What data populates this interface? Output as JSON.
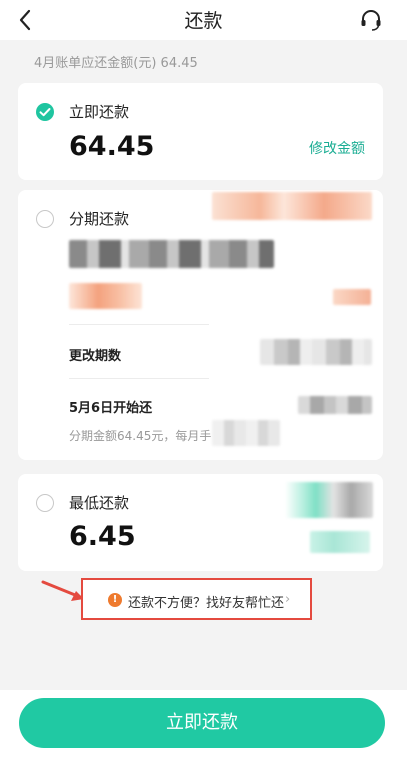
{
  "header": {
    "title": "还款",
    "back_icon": "chevron-left-icon",
    "support_icon": "headset-icon"
  },
  "summary": "4月账单应还金额(元) 64.45",
  "options": {
    "pay_now": {
      "label": "立即还款",
      "amount": "64.45",
      "edit_label": "修改金额",
      "selected": true
    },
    "installment": {
      "label": "分期还款",
      "change_periods_label": "更改期数",
      "start_label": "5月6日开始还",
      "note": "分期金额64.45元，每月手",
      "selected": false
    },
    "minimum": {
      "label": "最低还款",
      "amount": "6.45",
      "selected": false
    }
  },
  "help": {
    "icon": "info-icon",
    "text": "还款不方便？找好友帮忙还",
    "chevron": "›"
  },
  "footer": {
    "pay_button_label": "立即还款"
  },
  "colors": {
    "accent": "#20c9a3",
    "link": "#1aad93",
    "highlight_border": "#e44a3f",
    "info": "#ee7a2e"
  }
}
